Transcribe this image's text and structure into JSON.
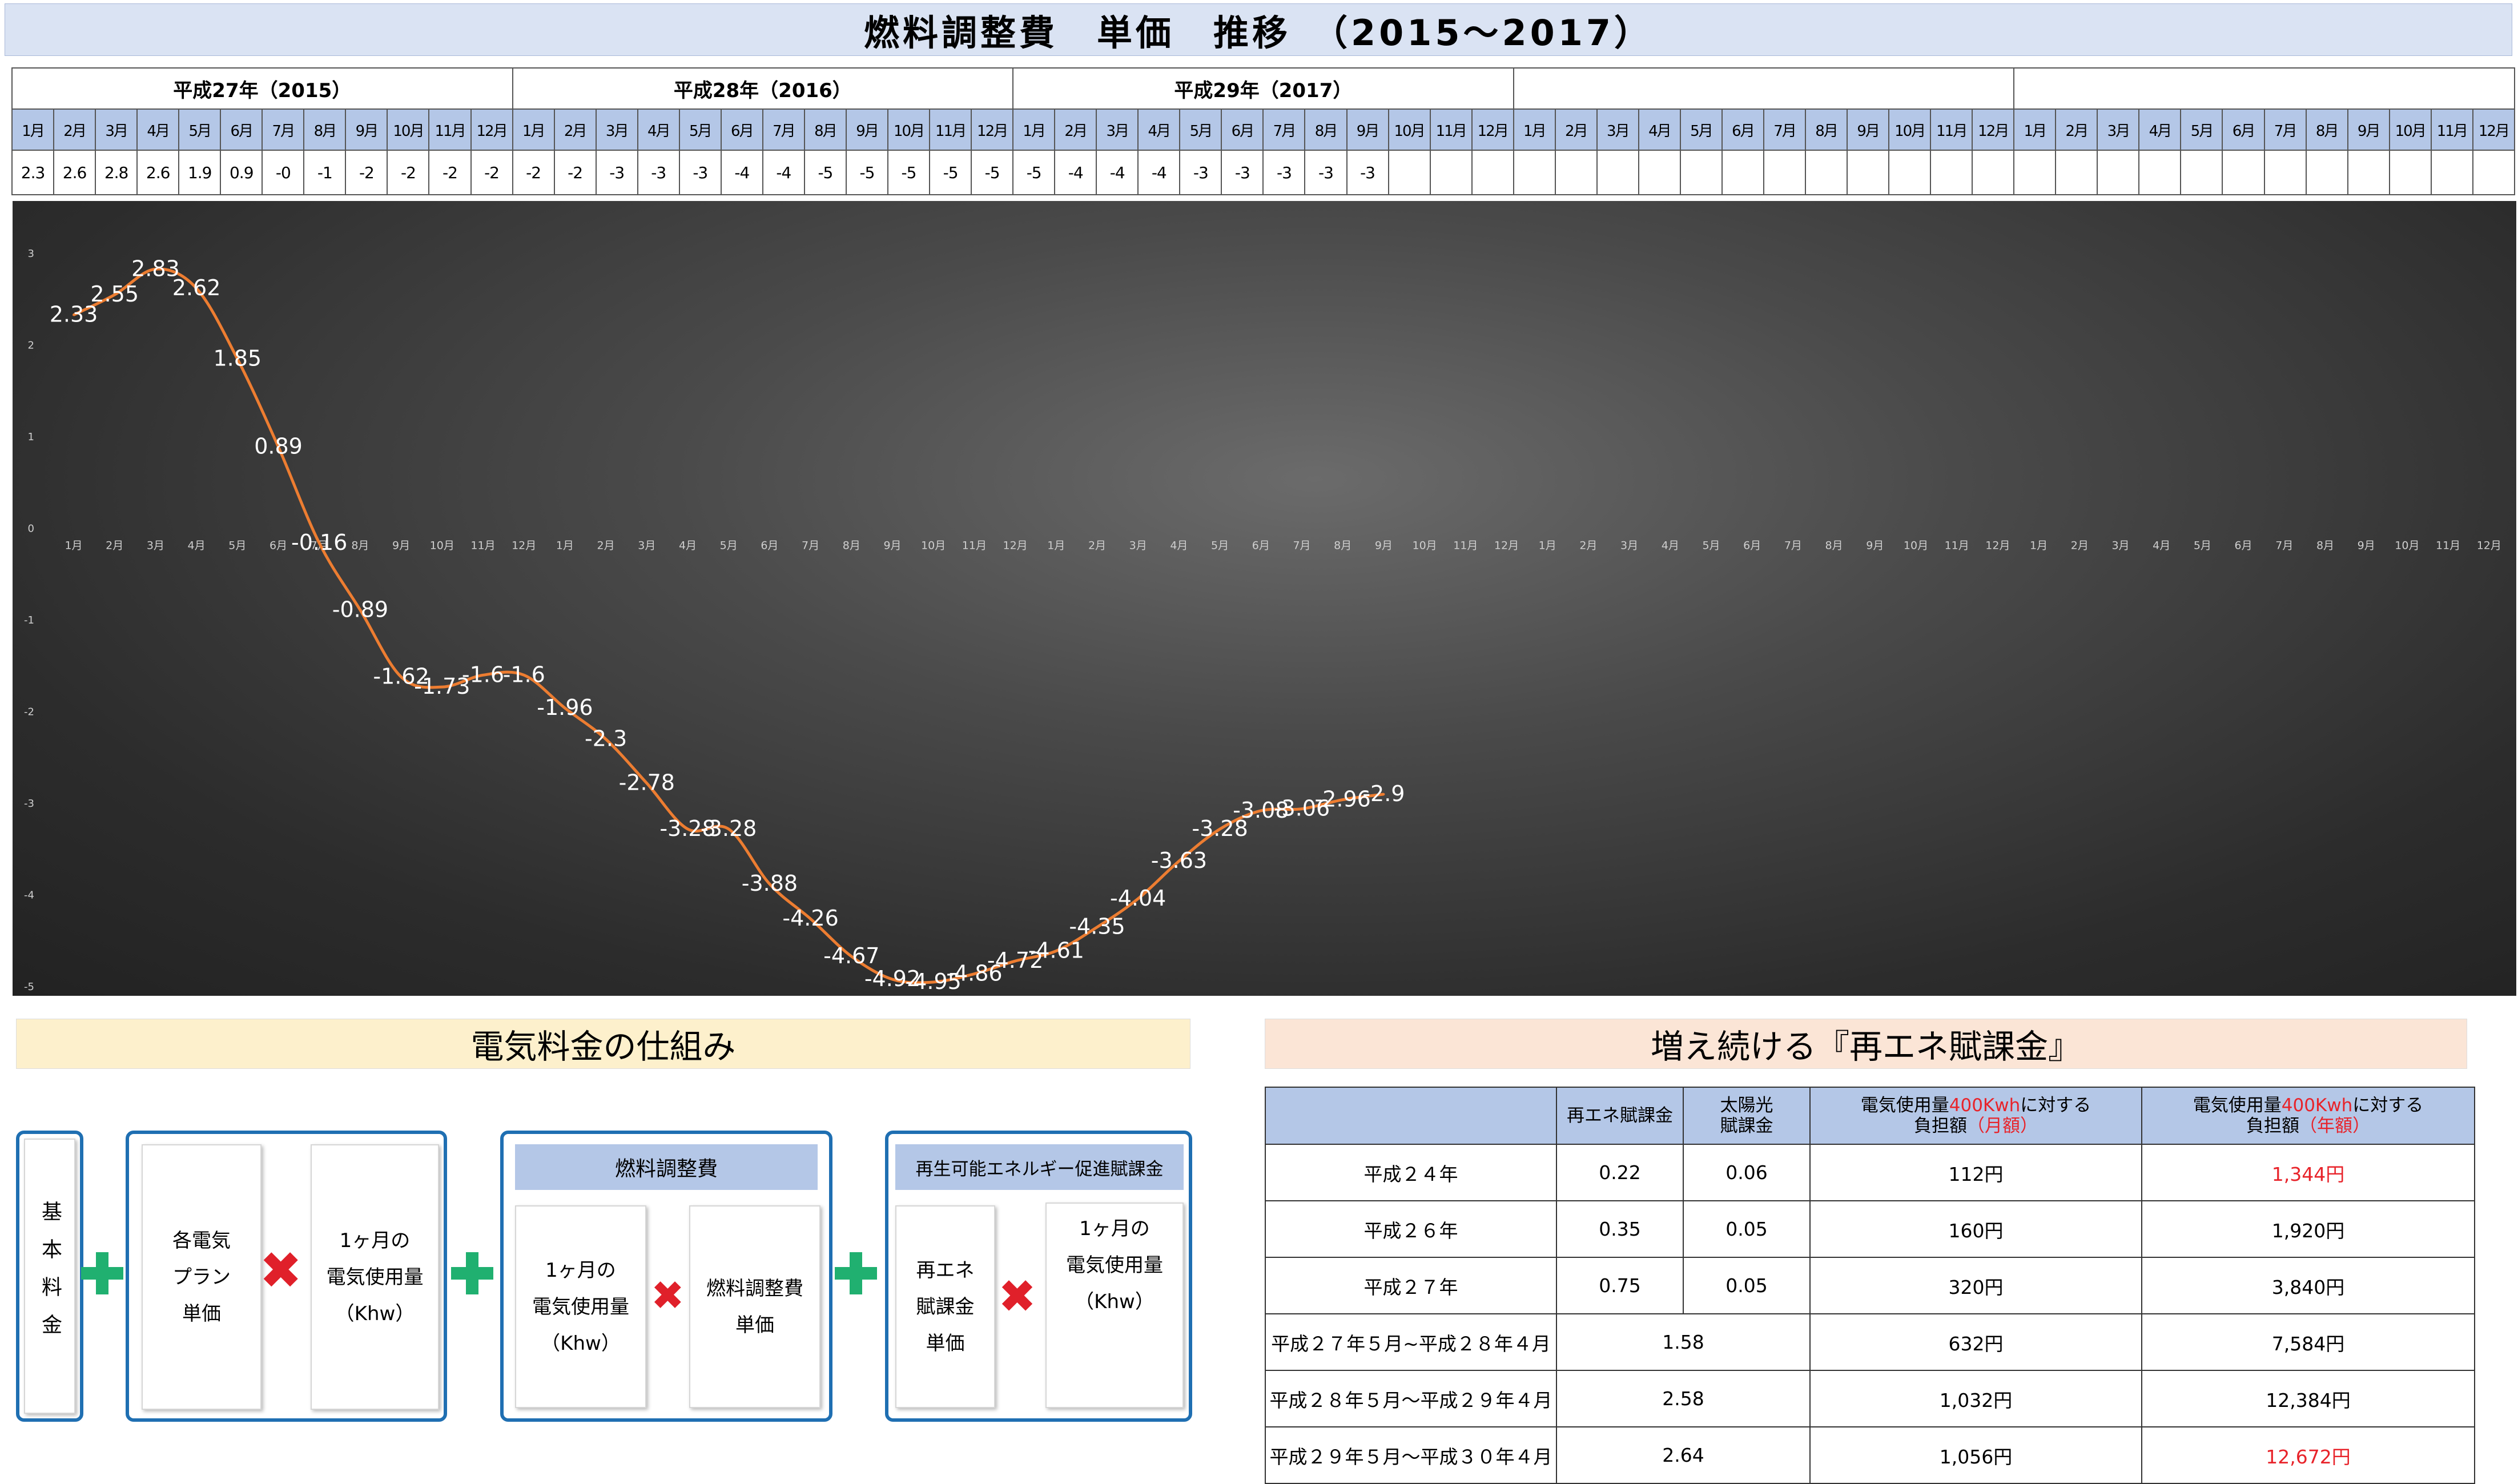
{
  "title": "燃料調整費　単価　推移　（2015～2017）",
  "years": [
    "平成27年（2015）",
    "平成28年（2016）",
    "平成29年（2017）",
    "",
    ""
  ],
  "months": [
    "1月",
    "2月",
    "3月",
    "4月",
    "5月",
    "6月",
    "7月",
    "8月",
    "9月",
    "10月",
    "11月",
    "12月"
  ],
  "table_values": [
    "2.3",
    "2.6",
    "2.8",
    "2.6",
    "1.9",
    "0.9",
    "-0",
    "-1",
    "-2",
    "-2",
    "-2",
    "-2",
    "-2",
    "-2",
    "-3",
    "-3",
    "-3",
    "-4",
    "-4",
    "-5",
    "-5",
    "-5",
    "-5",
    "-5",
    "-5",
    "-4",
    "-4",
    "-4",
    "-3",
    "-3",
    "-3",
    "-3",
    "-3"
  ],
  "chart_data": {
    "type": "line",
    "categories": [
      "1月",
      "2月",
      "3月",
      "4月",
      "5月",
      "6月",
      "7月",
      "8月",
      "9月",
      "10月",
      "11月",
      "12月",
      "1月",
      "2月",
      "3月",
      "4月",
      "5月",
      "6月",
      "7月",
      "8月",
      "9月",
      "10月",
      "11月",
      "12月",
      "1月",
      "2月",
      "3月",
      "4月",
      "5月",
      "6月",
      "7月",
      "8月",
      "9月",
      "10月",
      "11月",
      "12月",
      "1月",
      "2月",
      "3月",
      "4月",
      "5月",
      "6月",
      "7月",
      "8月",
      "9月",
      "10月",
      "11月",
      "12月",
      "1月",
      "2月",
      "3月",
      "4月",
      "5月",
      "6月",
      "7月",
      "8月",
      "9月",
      "10月",
      "11月",
      "12月"
    ],
    "values": [
      2.33,
      2.55,
      2.83,
      2.62,
      1.85,
      0.89,
      -0.16,
      -0.89,
      -1.62,
      -1.73,
      -1.6,
      -1.6,
      -1.96,
      -2.3,
      -2.78,
      -3.28,
      -3.28,
      -3.88,
      -4.26,
      -4.67,
      -4.92,
      -4.95,
      -4.86,
      -4.72,
      -4.61,
      -4.35,
      -4.04,
      -3.63,
      -3.28,
      -3.08,
      -3.06,
      -2.96,
      -2.9
    ],
    "ylim": [
      -5,
      3
    ],
    "yticks": [
      "3",
      "2",
      "1",
      "0",
      "-1",
      "-2",
      "-3",
      "-4",
      "-5"
    ],
    "line_color": "#ed7d31",
    "grid": false
  },
  "left_section": {
    "title": "電気料金の仕組み",
    "basic": "基本料金",
    "plan_unit": [
      "各電気",
      "プラン",
      "単価"
    ],
    "usage_1": [
      "1ヶ月の",
      "電気使用量",
      "（Khw）"
    ],
    "fuel_title": "燃料調整費",
    "usage_2": [
      "1ヶ月の",
      "電気使用量",
      "（Khw）"
    ],
    "fuel_unit": [
      "燃料調整費",
      "単価"
    ],
    "renew_title": "再生可能エネルギー促進賦課金",
    "renew_unit": [
      "再エネ",
      "賦課金",
      "単価"
    ],
    "usage_3": [
      "1ヶ月の",
      "電気使用量",
      "（Khw）"
    ]
  },
  "right_section": {
    "title": "増え続ける『再エネ賦課金』",
    "headers": {
      "col2": "再エネ賦課金",
      "col3a": "太陽光",
      "col3b": "賦課金",
      "col4_pre": "電気使用量",
      "col4_red": "400Kwh",
      "col4_post": "に対する",
      "col4_line2": "負担額",
      "col4_line2_red": "（月額）",
      "col5_pre": "電気使用量",
      "col5_red": "400Kwh",
      "col5_post": "に対する",
      "col5_line2": "負担額",
      "col5_line2_red": "（年額）"
    },
    "rows": [
      {
        "period": "平成２４年",
        "renew": "0.22",
        "solar": "0.06",
        "monthly": "112円",
        "yearly": "1,344円"
      },
      {
        "period": "平成２６年",
        "renew": "0.35",
        "solar": "0.05",
        "monthly": "160円",
        "yearly": "1,920円"
      },
      {
        "period": "平成２７年",
        "renew": "0.75",
        "solar": "0.05",
        "monthly": "320円",
        "yearly": "3,840円"
      },
      {
        "period": "平成２７年５月~平成２８年４月",
        "combined": "1.58",
        "monthly": "632円",
        "yearly": "7,584円"
      },
      {
        "period": "平成２８年５月～平成２９年４月",
        "combined": "2.58",
        "monthly": "1,032円",
        "yearly": "12,384円"
      },
      {
        "period": "平成２９年５月～平成３０年４月",
        "combined": "2.64",
        "monthly": "1,056円",
        "yearly": "12,672円"
      }
    ]
  }
}
